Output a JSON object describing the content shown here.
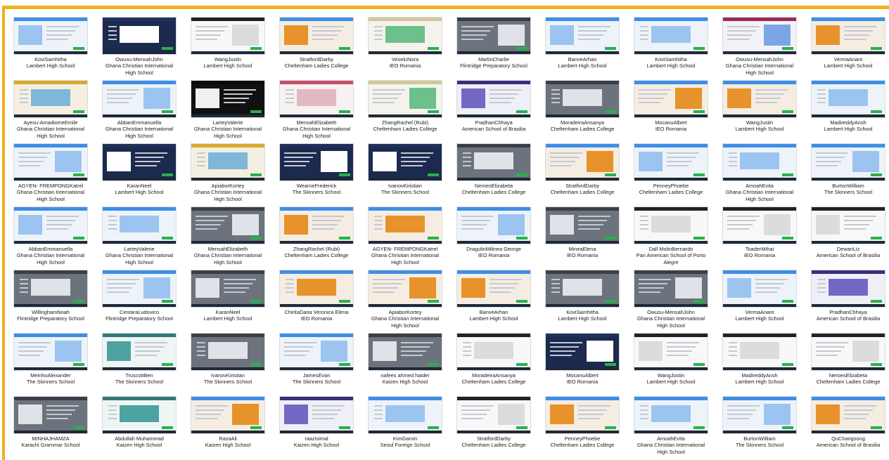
{
  "window": {
    "title": ""
  },
  "colors": {
    "accent_border": "#f2b01e"
  },
  "tiles": [
    {
      "name": "KoviSamhitha",
      "school": "Lambert High School",
      "theme": "blue"
    },
    {
      "name": "Owusu-MensahJohn",
      "school": "Ghana Christian International High School",
      "theme": "navy"
    },
    {
      "name": "WangJustin",
      "school": "Lambert High School",
      "theme": "white"
    },
    {
      "name": "StratfordDarby",
      "school": "Cheltenham Ladies College",
      "theme": "orange"
    },
    {
      "name": "VeseluNora",
      "school": "IEO Romania",
      "theme": "green"
    },
    {
      "name": "MartinCharlie",
      "school": "Flintridge Preparatory School",
      "theme": "gray"
    },
    {
      "name": "BanveArhan",
      "school": "Lambert High School",
      "theme": "blue"
    },
    {
      "name": "KoviSamhitha",
      "school": "Lambert High School",
      "theme": "blue"
    },
    {
      "name": "Owusu-MensahJohn",
      "school": "Ghana Christian International High School",
      "theme": "magenta"
    },
    {
      "name": "VermaAnant",
      "school": "Lambert High School",
      "theme": "orange"
    },
    {
      "name": "Ayesu-AmadiomeEmile",
      "school": "Ghana Christian International High School",
      "theme": "gold"
    },
    {
      "name": "AbbanEmmanuella",
      "school": "Ghana Christian International High School",
      "theme": "blue"
    },
    {
      "name": "LarteyValerie",
      "school": "Ghana Christian International High School",
      "theme": "black"
    },
    {
      "name": "MensahElizabeth",
      "school": "Ghana Christian International High School",
      "theme": "pink"
    },
    {
      "name": "ZhangRachel (Rubi)",
      "school": "Cheltenham Ladies College",
      "theme": "green"
    },
    {
      "name": "PradhanChhaya",
      "school": "American School of Brasilia",
      "theme": "purple"
    },
    {
      "name": "MoradeiraAnsanya",
      "school": "Cheltenham Ladies College",
      "theme": "gray"
    },
    {
      "name": "MocanuAlbert",
      "school": "IEO Romania",
      "theme": "orange"
    },
    {
      "name": "WangJustin",
      "school": "Lambert High School",
      "theme": "orange"
    },
    {
      "name": "MadireddyAnsh",
      "school": "Lambert High School",
      "theme": "blue"
    },
    {
      "name": "AGYEN- FREMPONGKatrel",
      "school": "Ghana Christian International High School",
      "theme": "blue"
    },
    {
      "name": "KaranNeel",
      "school": "Lambert High School",
      "theme": "navy"
    },
    {
      "name": "ApiaborKortey",
      "school": "Ghana Christian International High School",
      "theme": "gold"
    },
    {
      "name": "WearneFrederick",
      "school": "The Skinners   School",
      "theme": "navy"
    },
    {
      "name": "IvanovKiristian",
      "school": "The Skinners   School",
      "theme": "navy"
    },
    {
      "name": "NeroesElizabeta",
      "school": "Cheltenham Ladies College",
      "theme": "gray"
    },
    {
      "name": "StratfordDarby",
      "school": "Cheltenham Ladies College",
      "theme": "orange"
    },
    {
      "name": "PenneyPhoebe",
      "school": "Cheltenham Ladies College",
      "theme": "blue"
    },
    {
      "name": "AmoahEvita",
      "school": "Ghana Christian International High School",
      "theme": "blue"
    },
    {
      "name": "BurtonWilliam",
      "school": "The Skinners   School",
      "theme": "blue"
    },
    {
      "name": "AbbanEmmanuella",
      "school": "Ghana Christian International High School",
      "theme": "blue"
    },
    {
      "name": "LarteyValerie",
      "school": "Ghana Christian International High School",
      "theme": "blue"
    },
    {
      "name": "MensahElizabeth",
      "school": "Ghana Christian International High School",
      "theme": "gray"
    },
    {
      "name": "ZhangRachel (Rubi)",
      "school": "Cheltenham Ladies College",
      "theme": "orange"
    },
    {
      "name": "AGYEN- FREMPONGKatrel",
      "school": "Ghana Christian International High School",
      "theme": "orange"
    },
    {
      "name": "DragulinMilinea George",
      "school": "IEO Romania",
      "theme": "blue"
    },
    {
      "name": "MineaElena",
      "school": "IEO Romania",
      "theme": "gray"
    },
    {
      "name": "Dall MolinBernardo",
      "school": "Pan American School of Porto Alegre",
      "theme": "white"
    },
    {
      "name": "ToaderMihai",
      "school": "IEO Romania",
      "theme": "white"
    },
    {
      "name": "DewanLiz",
      "school": "American School of Brasilia",
      "theme": "white"
    },
    {
      "name": "WillinghamNoah",
      "school": "Flintridge Preparatory School",
      "theme": "gray"
    },
    {
      "name": "CentaraLudovico",
      "school": "Flintridge Preparatory School",
      "theme": "blue"
    },
    {
      "name": "KaranNeel",
      "school": "Lambert High School",
      "theme": "gray"
    },
    {
      "name": "ChiritaDaria Veronica Elena",
      "school": "IEO Romania",
      "theme": "orange"
    },
    {
      "name": "ApiaborKortey",
      "school": "Ghana Christian International High School",
      "theme": "orange"
    },
    {
      "name": "BanveArhan",
      "school": "Lambert High School",
      "theme": "orange"
    },
    {
      "name": "KoviSamhitha",
      "school": "Lambert High School",
      "theme": "gray"
    },
    {
      "name": "Owusu-MensahJohn",
      "school": "Ghana Christian International High School",
      "theme": "gray"
    },
    {
      "name": "VermaAnant",
      "school": "Lambert High School",
      "theme": "blue"
    },
    {
      "name": "PradhanChhaya",
      "school": "American School of Brasilia",
      "theme": "purple"
    },
    {
      "name": "MeinhoAlexander",
      "school": "The Skinners   School",
      "theme": "blue"
    },
    {
      "name": "TruscottBen",
      "school": "The Skinners   School",
      "theme": "teal"
    },
    {
      "name": "IvanovKiristian",
      "school": "The Skinners   School",
      "theme": "gray"
    },
    {
      "name": "JamesEvan",
      "school": "The Skinners   School",
      "theme": "blue"
    },
    {
      "name": "nafees ahmed haider",
      "school": "Kaizen High School",
      "theme": "gray"
    },
    {
      "name": "MoradeiraAnsanya",
      "school": "Cheltenham Ladies College",
      "theme": "white"
    },
    {
      "name": "MocanuAlbert",
      "school": "IEO Romania",
      "theme": "navy"
    },
    {
      "name": "WangJustin",
      "school": "Lambert High School",
      "theme": "white"
    },
    {
      "name": "MadireddyAnsh",
      "school": "Lambert High School",
      "theme": "white"
    },
    {
      "name": "NeroesElizabeta",
      "school": "Cheltenham Ladies College",
      "theme": "white"
    },
    {
      "name": "MINHAJHAMZA",
      "school": "Karachi Grammar School",
      "theme": "gray"
    },
    {
      "name": "Abdullah Muhammad",
      "school": "Kaizen High School",
      "theme": "teal"
    },
    {
      "name": "RazaAli",
      "school": "Kaizen High School",
      "theme": "orange"
    },
    {
      "name": "raazisimal",
      "school": "Kaizen High School",
      "theme": "purple"
    },
    {
      "name": "KimGarvin",
      "school": "Seoul Foreign School",
      "theme": "blue"
    },
    {
      "name": "StratfordDarby",
      "school": "Cheltenham Ladies College",
      "theme": "white"
    },
    {
      "name": "PenneyPhoebe",
      "school": "Cheltenham Ladies College",
      "theme": "orange"
    },
    {
      "name": "AmoahEvita",
      "school": "Ghana Christian International High School",
      "theme": "blue"
    },
    {
      "name": "BurtonWilliam",
      "school": "The Skinners   School",
      "theme": "blue"
    },
    {
      "name": "QuChangsong",
      "school": "American School of Brasilia",
      "theme": "orange"
    }
  ],
  "themes": {
    "blue": {
      "bar": "#3d8ee8",
      "bg": "#eef3fa",
      "blk": "#9cc4f0"
    },
    "navy": {
      "bar": "#20305a",
      "bg": "#1c2a4f",
      "blk": "#ffffff"
    },
    "white": {
      "bar": "#222222",
      "bg": "#f8f8f8",
      "blk": "#dcdcdc"
    },
    "orange": {
      "bar": "#3d8ee8",
      "bg": "#f5ede2",
      "blk": "#e7922b"
    },
    "green": {
      "bar": "#d3c79a",
      "bg": "#f4f4ec",
      "blk": "#6cc08a"
    },
    "gray": {
      "bar": "#3a3f47",
      "bg": "#6d737c",
      "blk": "#dfe3e8"
    },
    "magenta": {
      "bar": "#9b2a5a",
      "bg": "#f2f2f6",
      "blk": "#7aa6e6"
    },
    "gold": {
      "bar": "#d9a92e",
      "bg": "#f4efe0",
      "blk": "#7fb7d9"
    },
    "black": {
      "bar": "#0b0b0b",
      "bg": "#111111",
      "blk": "#f0f0f0"
    },
    "pink": {
      "bar": "#c94d6a",
      "bg": "#f6f2f2",
      "blk": "#e3b9c2"
    },
    "purple": {
      "bar": "#3b2d7a",
      "bg": "#efeff7",
      "blk": "#7468c5"
    },
    "teal": {
      "bar": "#2f7a73",
      "bg": "#eef5f4",
      "blk": "#4ca3a0"
    }
  }
}
